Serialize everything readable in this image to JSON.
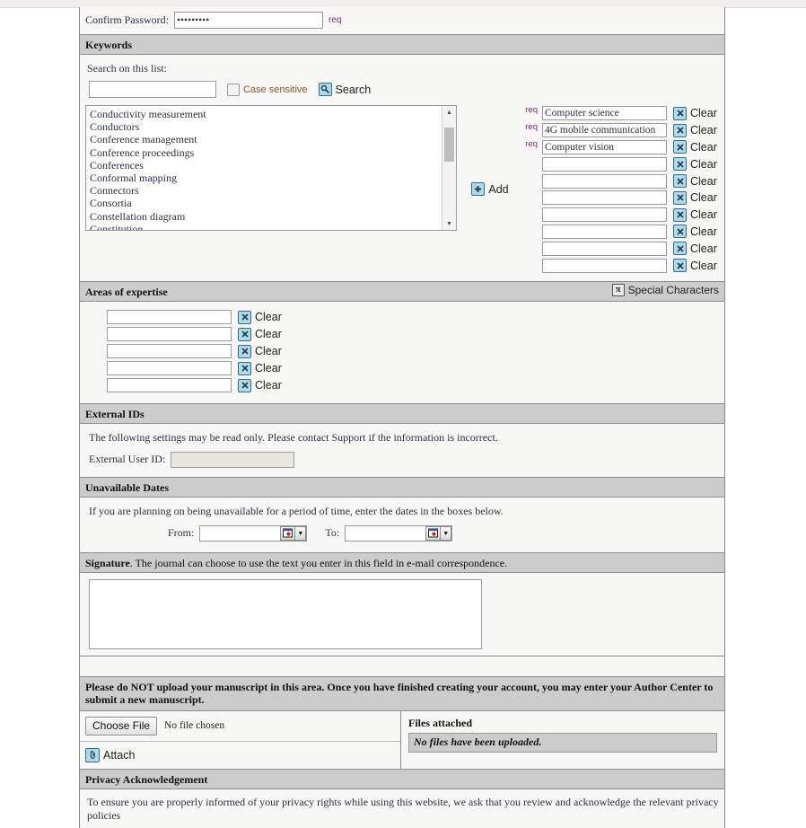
{
  "password_section": {
    "label": "Confirm Password:",
    "value": "•••••••••",
    "req": "req"
  },
  "keywords": {
    "heading": "Keywords",
    "search_label": "Search on this list:",
    "search_value": "",
    "case_sensitive_label": "Case sensitive",
    "search_button": "Search",
    "search_icon": "magnifier-icon",
    "add_button": "Add",
    "add_icon": "plus-icon",
    "list_items": [
      "Conductivity measurement",
      "Conductors",
      "Conference management",
      "Conference proceedings",
      "Conferences",
      "Conformal mapping",
      "Connectors",
      "Consortia",
      "Constellation diagram",
      "Constitution"
    ],
    "clear_label": "Clear",
    "clear_icon": "x-icon",
    "fields": [
      {
        "req": "req",
        "value": "Computer science"
      },
      {
        "req": "req",
        "value": "4G mobile communication"
      },
      {
        "req": "req",
        "value": "Computer vision"
      },
      {
        "req": "",
        "value": ""
      },
      {
        "req": "",
        "value": ""
      },
      {
        "req": "",
        "value": ""
      },
      {
        "req": "",
        "value": ""
      },
      {
        "req": "",
        "value": ""
      },
      {
        "req": "",
        "value": ""
      },
      {
        "req": "",
        "value": ""
      }
    ]
  },
  "expertise": {
    "heading": "Areas of expertise",
    "special_characters_label": "Special Characters",
    "special_characters_icon": "pi-icon",
    "clear_label": "Clear",
    "fields": [
      "",
      "",
      "",
      "",
      ""
    ]
  },
  "external_ids": {
    "heading": "External IDs",
    "note": "The following settings may be read only. Please contact Support if the information is incorrect.",
    "user_id_label": "External User ID:",
    "user_id_value": ""
  },
  "unavailable_dates": {
    "heading": "Unavailable Dates",
    "note": "If you are planning on being unavailable for a period of time, enter the dates in the boxes below.",
    "from_label": "From:",
    "from_value": "",
    "to_label": "To:",
    "to_value": "",
    "calendar_icon": "calendar-icon",
    "dropdown_icon": "chevron-down-icon"
  },
  "signature": {
    "heading_bold": "Signature",
    "heading_rest": ". The journal can choose to use the text you enter in this field in e-mail correspondence.",
    "value": ""
  },
  "upload": {
    "warning": "Please do NOT upload your manuscript in this area. Once you have finished creating your account, you may enter your Author Center to submit a new manuscript.",
    "choose_file_button": "Choose File",
    "no_file_text": "No file chosen",
    "attach_button": "Attach",
    "attach_icon": "paperclip-icon",
    "files_attached_title": "Files attached",
    "files_attached_status": "No files have been uploaded."
  },
  "privacy": {
    "heading": "Privacy Acknowledgement",
    "text": "To ensure you are properly informed of your privacy rights while using this website, we ask that you review and acknowledge the relevant privacy policies"
  },
  "colors": {
    "section_header": "#cccccc",
    "body": "#f7f7f5",
    "req": "#7d2b7d",
    "icon_blue": "#a8dcee"
  }
}
